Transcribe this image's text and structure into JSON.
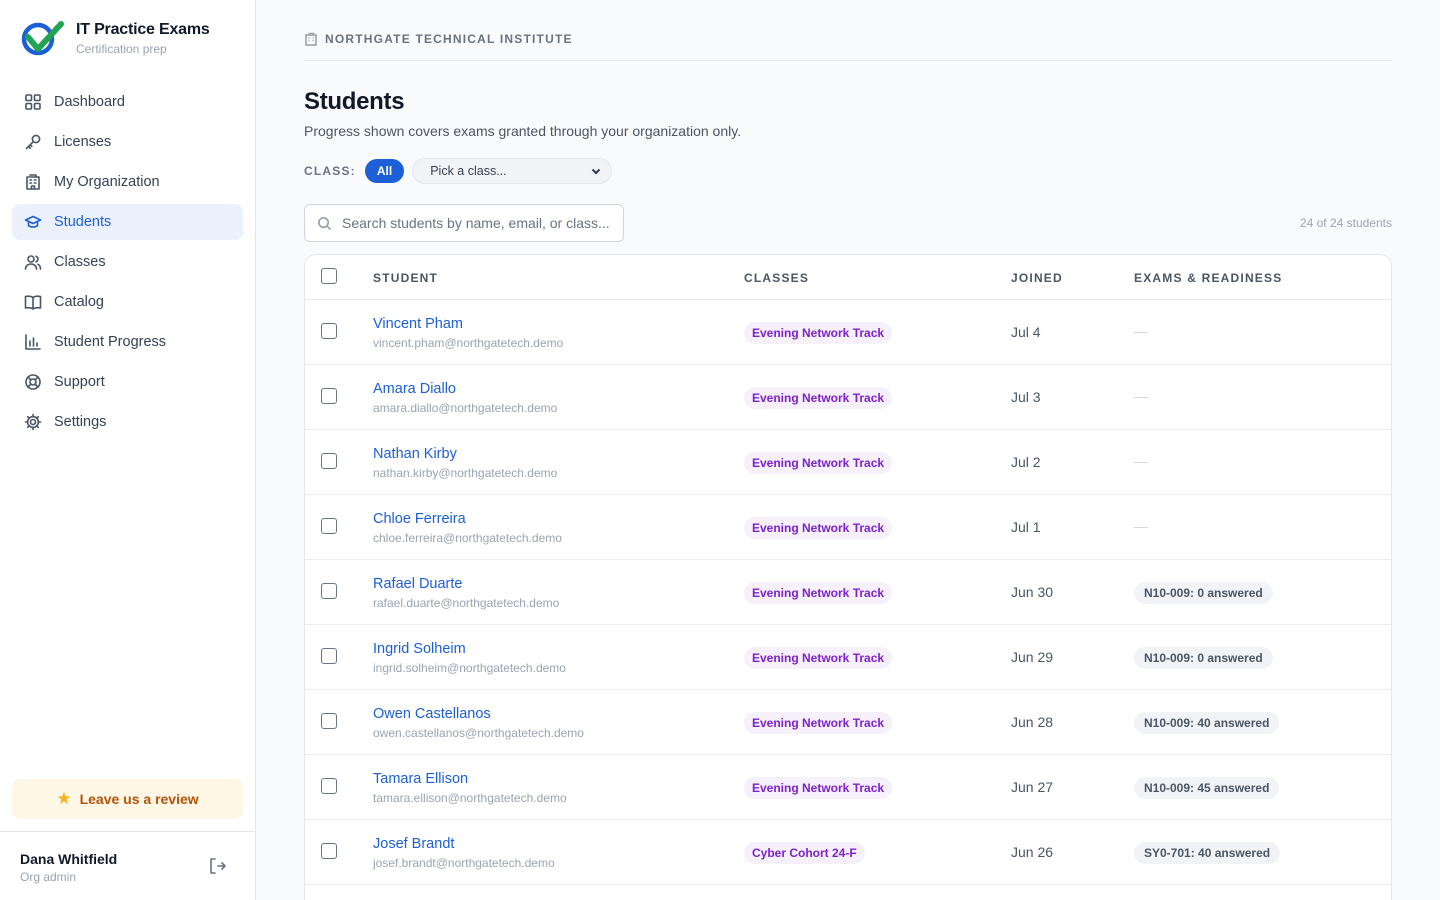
{
  "brand": {
    "title": "IT Practice Exams",
    "subtitle": "Certification prep"
  },
  "nav": [
    {
      "label": "Dashboard",
      "icon": "grid-icon",
      "active": false
    },
    {
      "label": "Licenses",
      "icon": "key-icon",
      "active": false
    },
    {
      "label": "My Organization",
      "icon": "building-icon",
      "active": false
    },
    {
      "label": "Students",
      "icon": "graduation-cap-icon",
      "active": true
    },
    {
      "label": "Classes",
      "icon": "users-icon",
      "active": false
    },
    {
      "label": "Catalog",
      "icon": "book-icon",
      "active": false
    },
    {
      "label": "Student Progress",
      "icon": "bar-chart-icon",
      "active": false
    },
    {
      "label": "Support",
      "icon": "lifebuoy-icon",
      "active": false
    },
    {
      "label": "Settings",
      "icon": "gear-icon",
      "active": false
    }
  ],
  "review": {
    "label": "Leave us a review"
  },
  "user": {
    "name": "Dana Whitfield",
    "role": "Org admin"
  },
  "org": {
    "name": "NORTHGATE TECHNICAL INSTITUTE"
  },
  "page": {
    "title": "Students",
    "subtitle": "Progress shown covers exams granted through your organization only."
  },
  "class_filter": {
    "label": "CLASS:",
    "all_label": "All",
    "select_value": "Pick a class..."
  },
  "search": {
    "placeholder": "Search students by name, email, or class..."
  },
  "count_text": "24 of 24 students",
  "table": {
    "headers": {
      "student": "STUDENT",
      "classes": "CLASSES",
      "joined": "JOINED",
      "exams": "EXAMS & READINESS"
    },
    "rows": [
      {
        "name": "Vincent Pham",
        "email": "vincent.pham@northgatetech.demo",
        "class": "Evening Network Track",
        "joined": "Jul 4",
        "exam": ""
      },
      {
        "name": "Amara Diallo",
        "email": "amara.diallo@northgatetech.demo",
        "class": "Evening Network Track",
        "joined": "Jul 3",
        "exam": ""
      },
      {
        "name": "Nathan Kirby",
        "email": "nathan.kirby@northgatetech.demo",
        "class": "Evening Network Track",
        "joined": "Jul 2",
        "exam": ""
      },
      {
        "name": "Chloe Ferreira",
        "email": "chloe.ferreira@northgatetech.demo",
        "class": "Evening Network Track",
        "joined": "Jul 1",
        "exam": ""
      },
      {
        "name": "Rafael Duarte",
        "email": "rafael.duarte@northgatetech.demo",
        "class": "Evening Network Track",
        "joined": "Jun 30",
        "exam": "N10-009: 0 answered"
      },
      {
        "name": "Ingrid Solheim",
        "email": "ingrid.solheim@northgatetech.demo",
        "class": "Evening Network Track",
        "joined": "Jun 29",
        "exam": "N10-009: 0 answered"
      },
      {
        "name": "Owen Castellanos",
        "email": "owen.castellanos@northgatetech.demo",
        "class": "Evening Network Track",
        "joined": "Jun 28",
        "exam": "N10-009: 40 answered"
      },
      {
        "name": "Tamara Ellison",
        "email": "tamara.ellison@northgatetech.demo",
        "class": "Evening Network Track",
        "joined": "Jun 27",
        "exam": "N10-009: 45 answered"
      },
      {
        "name": "Josef Brandt",
        "email": "josef.brandt@northgatetech.demo",
        "class": "Cyber Cohort 24-F",
        "joined": "Jun 26",
        "exam": "SY0-701: 40 answered"
      }
    ],
    "empty_exam_symbol": "—"
  },
  "colors": {
    "accent": "#1d5fd6",
    "class_tag": "#7e22ce",
    "review": "#b45309",
    "star": "#f5b324"
  }
}
